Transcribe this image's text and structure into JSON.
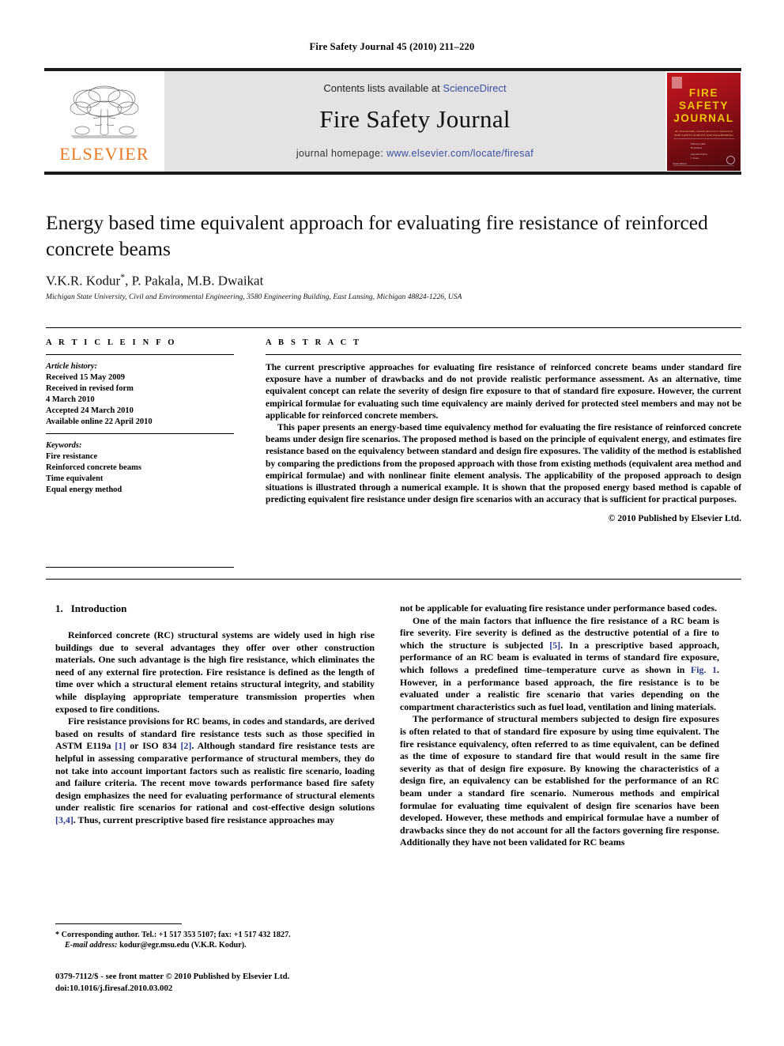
{
  "running_head": "Fire Safety Journal 45 (2010) 211–220",
  "masthead": {
    "publisher_logo_label": "ELSEVIER",
    "contents_prefix": "Contents lists available at ",
    "contents_link": "ScienceDirect",
    "journal_title": "Fire Safety Journal",
    "homepage_prefix": "journal homepage: ",
    "homepage_url": "www.elsevier.com/locate/firesaf",
    "cover": {
      "title_line1": "FIRE",
      "title_line2": "SAFETY",
      "title_line3": "JOURNAL",
      "subtitle": "An International Journal devoted to research in FIRE SAFETY SCIENCE AND ENGINEERING",
      "editor_block": "Editor-in-Chief\nB. Karlsson\n\nAssociate Editors\nJ. Torero\nG. Rein",
      "band_note": "Official Journal of the International Association for Fire Safety Science",
      "footer_note": "Available online at\nScienceDirect\nwww.sciencedirect.com"
    }
  },
  "article": {
    "title": "Energy based time equivalent approach for evaluating fire resistance of reinforced concrete beams",
    "authors": "V.K.R. Kodur",
    "authors_rest": ", P. Pakala, M.B. Dwaikat",
    "corresponding_marker": "*",
    "affiliation": "Michigan State University, Civil and Environmental Engineering, 3580 Engineering Building, East Lansing, Michigan 48824-1226, USA"
  },
  "article_info": {
    "heading": "A R T I C L E   I N F O",
    "history_label": "Article history:",
    "history_lines": [
      "Received 15 May 2009",
      "Received in revised form",
      "4 March 2010",
      "Accepted 24 March 2010",
      "Available online 22 April 2010"
    ],
    "keywords_label": "Keywords:",
    "keywords": [
      "Fire resistance",
      "Reinforced concrete beams",
      "Time equivalent",
      "Equal energy method"
    ]
  },
  "abstract": {
    "heading": "A B S T R A C T",
    "paragraphs": [
      "The current prescriptive approaches for evaluating fire resistance of reinforced concrete beams under standard fire exposure have a number of drawbacks and do not provide realistic performance assessment. As an alternative, time equivalent concept can relate the severity of design fire exposure to that of standard fire exposure. However, the current empirical formulae for evaluating such time equivalency are mainly derived for protected steel members and may not be applicable for reinforced concrete members.",
      "This paper presents an energy-based time equivalency method for evaluating the fire resistance of reinforced concrete beams under design fire scenarios. The proposed method is based on the principle of equivalent energy, and estimates fire resistance based on the equivalency between standard and design fire exposures. The validity of the method is established by comparing the predictions from the proposed approach with those from existing methods (equivalent area method and empirical formulae) and with nonlinear finite element analysis. The applicability of the proposed approach to design situations is illustrated through a numerical example. It is shown that the proposed energy based method is capable of predicting equivalent fire resistance under design fire scenarios with an accuracy that is sufficient for practical purposes."
    ],
    "copyright": "© 2010 Published by Elsevier Ltd."
  },
  "body": {
    "section_number": "1.",
    "section_title": "Introduction",
    "left_paragraphs": [
      "Reinforced concrete (RC) structural systems are widely used in high rise buildings due to several advantages they offer over other construction materials. One such advantage is the high fire resistance, which eliminates the need of any external fire protection. Fire resistance is defined as the length of time over which a structural element retains structural integrity, and stability while displaying appropriate temperature transmission properties when exposed to fire conditions."
    ],
    "left_paragraph_2_parts": {
      "a": "Fire resistance provisions for RC beams, in codes and standards, are derived based on results of standard fire resistance tests such as those specified in ASTM E119a ",
      "ref1": "[1]",
      "b": " or ISO 834 ",
      "ref2": "[2]",
      "c": ". Although standard fire resistance tests are helpful in assessing comparative performance of structural members, they do not take into account important factors such as realistic fire scenario, loading and failure criteria. The recent move towards performance based fire safety design emphasizes the need for evaluating performance of structural elements under realistic fire scenarios for rational and cost-effective design solutions ",
      "ref3": "[3,4]",
      "d": ". Thus, current prescriptive based fire resistance approaches may"
    },
    "right_paragraph_1": "not be applicable for evaluating fire resistance under performance based codes.",
    "right_paragraph_2_parts": {
      "a": "One of the main factors that influence the fire resistance of a RC beam is fire severity. Fire severity is defined as the destructive potential of a fire to which the structure is subjected ",
      "ref5": "[5]",
      "b": ". In a prescriptive based approach, performance of an RC beam is evaluated in terms of standard fire exposure, which follows a predefined time–temperature curve as shown in ",
      "figref": "Fig. 1",
      "c": ". However, in a performance based approach, the fire resistance is to be evaluated under a realistic fire scenario that varies depending on the compartment characteristics such as fuel load, ventilation and lining materials."
    },
    "right_paragraph_3": "The performance of structural members subjected to design fire exposures is often related to that of standard fire exposure by using time equivalent. The fire resistance equivalency, often referred to as time equivalent, can be defined as the time of exposure to standard fire that would result in the same fire severity as that of design fire exposure. By knowing the characteristics of a design fire, an equivalency can be established for the performance of an RC beam under a standard fire scenario. Numerous methods and empirical formulae for evaluating time equivalent of design fire scenarios have been developed. However, these methods and empirical formulae have a number of drawbacks since they do not account for all the factors governing fire response. Additionally they have not been validated for RC beams"
  },
  "footnotes": {
    "corresponding_marker": "*",
    "corresponding_text": "Corresponding author. Tel.: +1 517 353 5107; fax: +1 517 432 1827.",
    "email_label": "E-mail address:",
    "email_value": "kodur@egr.msu.edu (V.K.R. Kodur)."
  },
  "imprint": {
    "issn_line": "0379-7112/$ - see front matter © 2010 Published by Elsevier Ltd.",
    "doi_line": "doi:10.1016/j.firesaf.2010.03.002"
  },
  "colors": {
    "elsevier_orange": "#e87722",
    "link_blue": "#3b4ea0",
    "reference_blue": "#2b3a8f",
    "masthead_grey": "#e3e3e3",
    "cover_red": "#a8121a",
    "cover_yellow": "#f2c500"
  }
}
